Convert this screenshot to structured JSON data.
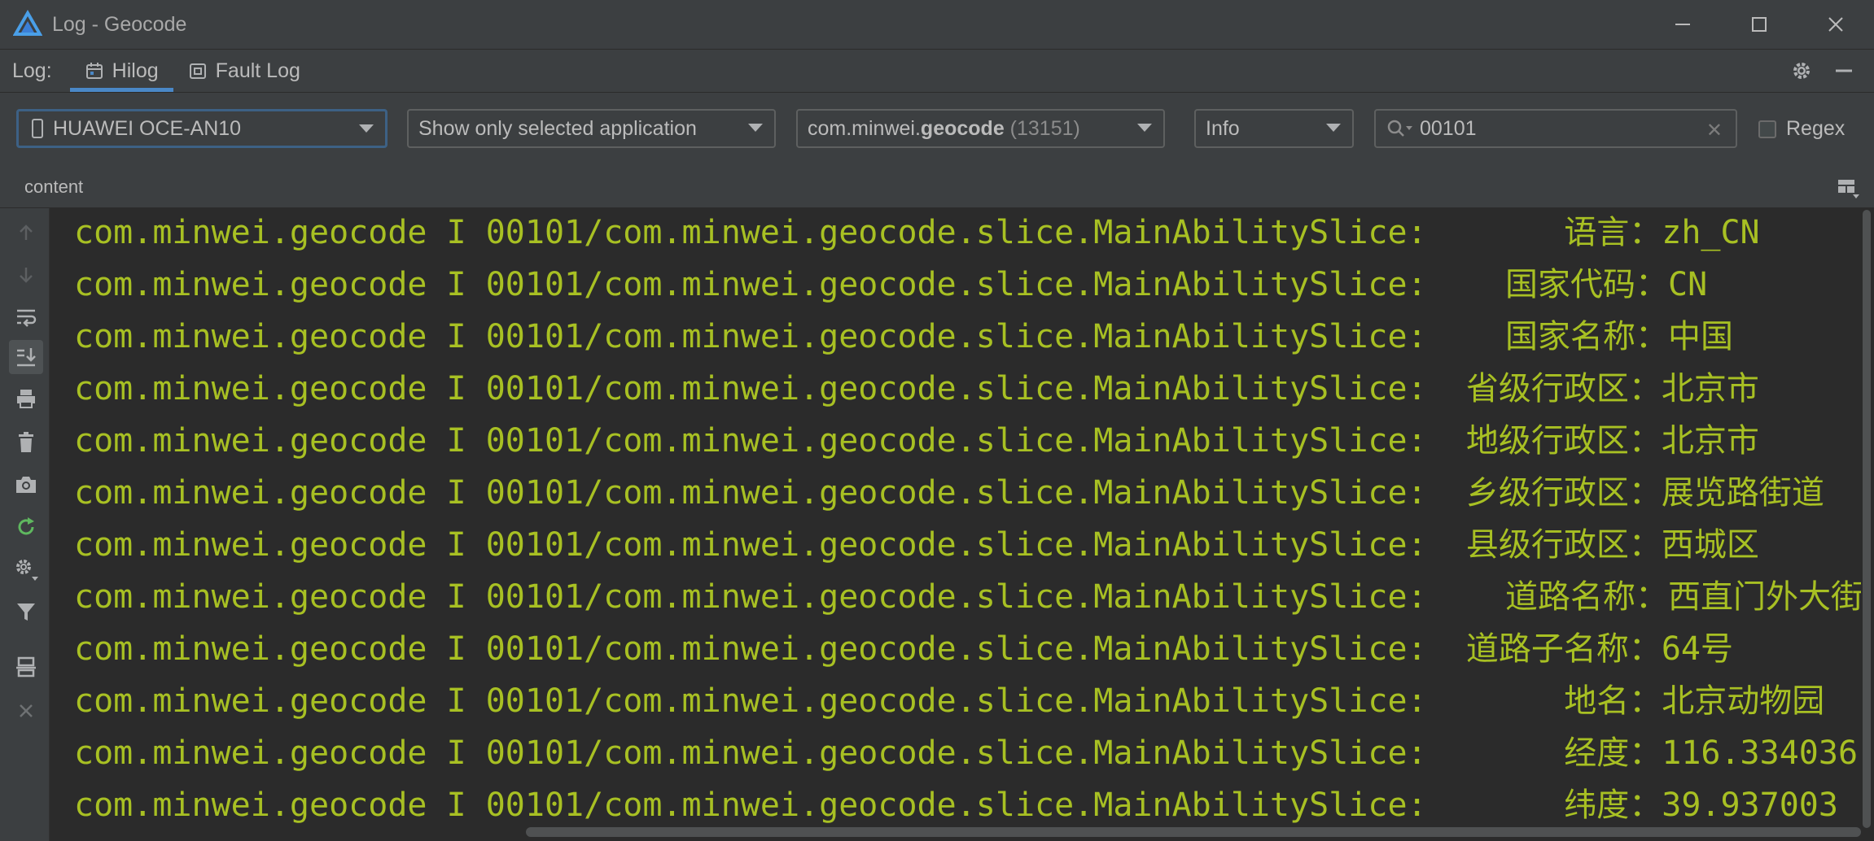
{
  "window": {
    "title": "Log - Geocode"
  },
  "toolwindow": {
    "label": "Log:",
    "tabs": [
      {
        "label": "Hilog",
        "active": true
      },
      {
        "label": "Fault Log",
        "active": false
      }
    ]
  },
  "filters": {
    "device": "HUAWEI OCE-AN10",
    "mode": "Show only selected application",
    "app_prefix": "com.minwei.",
    "app_bold": "geocode",
    "app_pid": " (13151)",
    "level": "Info",
    "search_value": "00101",
    "regex_label": "Regex",
    "regex_checked": false
  },
  "content": {
    "label": "content"
  },
  "log_lines": [
    "com.minwei.geocode I 00101/com.minwei.geocode.slice.MainAbilitySlice:       语言：zh_CN",
    "com.minwei.geocode I 00101/com.minwei.geocode.slice.MainAbilitySlice:    国家代码：CN",
    "com.minwei.geocode I 00101/com.minwei.geocode.slice.MainAbilitySlice:    国家名称：中国",
    "com.minwei.geocode I 00101/com.minwei.geocode.slice.MainAbilitySlice:  省级行政区：北京市",
    "com.minwei.geocode I 00101/com.minwei.geocode.slice.MainAbilitySlice:  地级行政区：北京市",
    "com.minwei.geocode I 00101/com.minwei.geocode.slice.MainAbilitySlice:  乡级行政区：展览路街道",
    "com.minwei.geocode I 00101/com.minwei.geocode.slice.MainAbilitySlice:  县级行政区：西城区",
    "com.minwei.geocode I 00101/com.minwei.geocode.slice.MainAbilitySlice:    道路名称：西直门外大街",
    "com.minwei.geocode I 00101/com.minwei.geocode.slice.MainAbilitySlice:  道路子名称：64号",
    "com.minwei.geocode I 00101/com.minwei.geocode.slice.MainAbilitySlice:       地名：北京动物园",
    "com.minwei.geocode I 00101/com.minwei.geocode.slice.MainAbilitySlice:       经度：116.334036",
    "com.minwei.geocode I 00101/com.minwei.geocode.slice.MainAbilitySlice:       纬度：39.937003"
  ],
  "colors": {
    "log_text": "#a8c023",
    "console_bg": "#2b2b2b",
    "panel_bg": "#3c3f41",
    "accent": "#4a88c7"
  }
}
